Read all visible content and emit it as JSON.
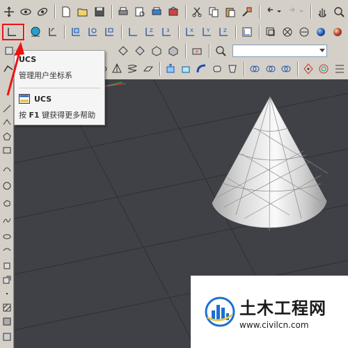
{
  "tooltip": {
    "title": "UCS",
    "description": "管理用户坐标系",
    "command_name": "UCS",
    "help_prefix": "按",
    "help_key": "F1",
    "help_suffix": "键获得更多帮助"
  },
  "watermark": {
    "name": "土木工程网",
    "url": "www.civilcn.com"
  },
  "colors": {
    "toolbar_bg": "#d4d0c8",
    "viewport_bg": "#3f4147",
    "highlight": "#e11111",
    "cone_light": "#f0f0f0",
    "cone_dark": "#9a9a9a",
    "watermark_blue": "#1d6fcf"
  },
  "icons": [
    "pan-icon",
    "orbit-icon",
    "free-orbit-icon",
    "new-file-icon",
    "open-file-icon",
    "save-icon",
    "print-icon",
    "print-preview-icon",
    "plot-icon",
    "publish-icon",
    "cut-icon",
    "copy-icon",
    "paste-icon",
    "match-properties-icon",
    "undo-icon",
    "redo-icon",
    "hand-pan-icon",
    "zoom-icon",
    "ucs-icon",
    "world-ucs-icon",
    "ucs-previous-icon",
    "face-ucs-icon",
    "object-ucs-icon",
    "view-ucs-icon",
    "origin-ucs-icon",
    "zaxis-ucs-icon",
    "3point-ucs-icon",
    "x-ucs-icon",
    "y-ucs-icon",
    "z-ucs-icon",
    "apply-ucs-icon",
    "visual-style-icons"
  ]
}
